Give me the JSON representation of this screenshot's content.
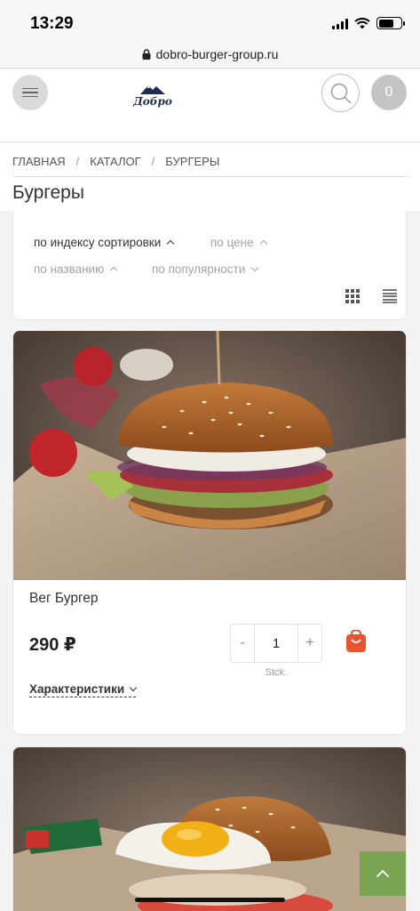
{
  "status_bar": {
    "time": "13:29"
  },
  "browser": {
    "url": "dobro-burger-group.ru"
  },
  "header": {
    "logo_text": "Добро",
    "cart_count": "0"
  },
  "breadcrumb": [
    "ГЛАВНАЯ",
    "КАТАЛОГ",
    "БУРГЕРЫ"
  ],
  "breadcrumb_separator": "/",
  "page_title": "Бургеры",
  "sort": {
    "options": [
      {
        "label": "по индексу сортировки",
        "active": true,
        "direction": "up"
      },
      {
        "label": "по цене",
        "active": false,
        "direction": "up"
      },
      {
        "label": "по названию",
        "active": false,
        "direction": "up"
      },
      {
        "label": "по популярности",
        "active": false,
        "direction": "down"
      }
    ]
  },
  "products": [
    {
      "name": "Вег Бургер",
      "price": "290 ₽",
      "quantity": "1",
      "minus": "-",
      "plus": "+",
      "unit": "Stck.",
      "specs_label": "Характеристики"
    }
  ],
  "colors": {
    "accent_green": "#79a553",
    "cart_icon": "#e8552f"
  }
}
